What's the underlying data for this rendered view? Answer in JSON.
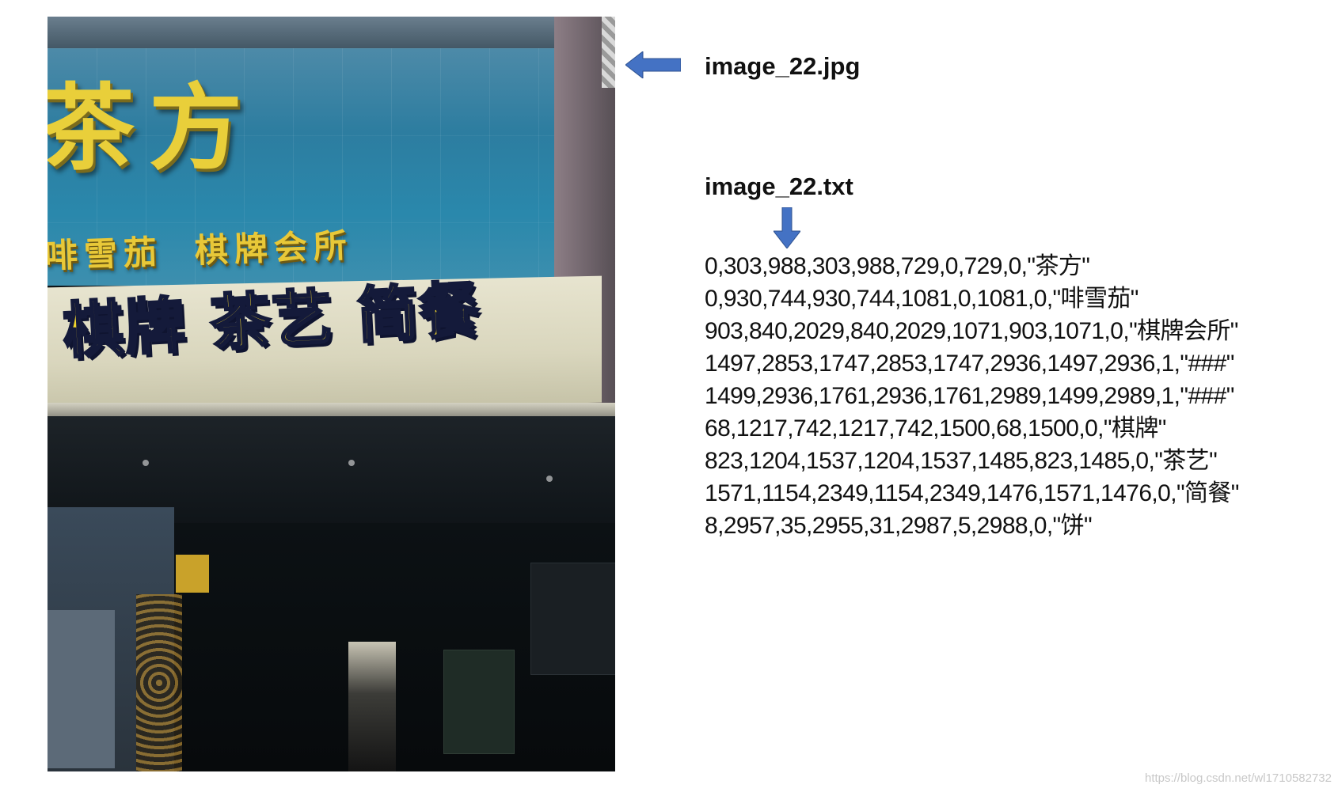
{
  "photo": {
    "sign_big": "茶方",
    "sign_mid": [
      "啡雪茄",
      "棋牌会所"
    ],
    "sign_low": [
      "棋牌",
      "茶艺",
      "简餐"
    ]
  },
  "labels": {
    "image_file": "image_22.jpg",
    "text_file": "image_22.txt"
  },
  "annotation_lines": [
    "0,303,988,303,988,729,0,729,0,\"茶方\"",
    "0,930,744,930,744,1081,0,1081,0,\"啡雪茄\"",
    "903,840,2029,840,2029,1071,903,1071,0,\"棋牌会所\"",
    "1497,2853,1747,2853,1747,2936,1497,2936,1,\"###\"",
    "1499,2936,1761,2936,1761,2989,1499,2989,1,\"###\"",
    "68,1217,742,1217,742,1500,68,1500,0,\"棋牌\"",
    "823,1204,1537,1204,1537,1485,823,1485,0,\"茶艺\"",
    "1571,1154,2349,1154,2349,1476,1571,1476,0,\"简餐\"",
    "8,2957,35,2955,31,2987,5,2988,0,\"饼\""
  ],
  "watermark": "https://blog.csdn.net/wl1710582732",
  "colors": {
    "arrow": "#4472c4",
    "sign_gold": "#e9cf3a",
    "sign_blue": "#2d7da0"
  },
  "icons": {
    "left_arrow": "arrow-left-icon",
    "down_arrow": "arrow-down-icon"
  }
}
